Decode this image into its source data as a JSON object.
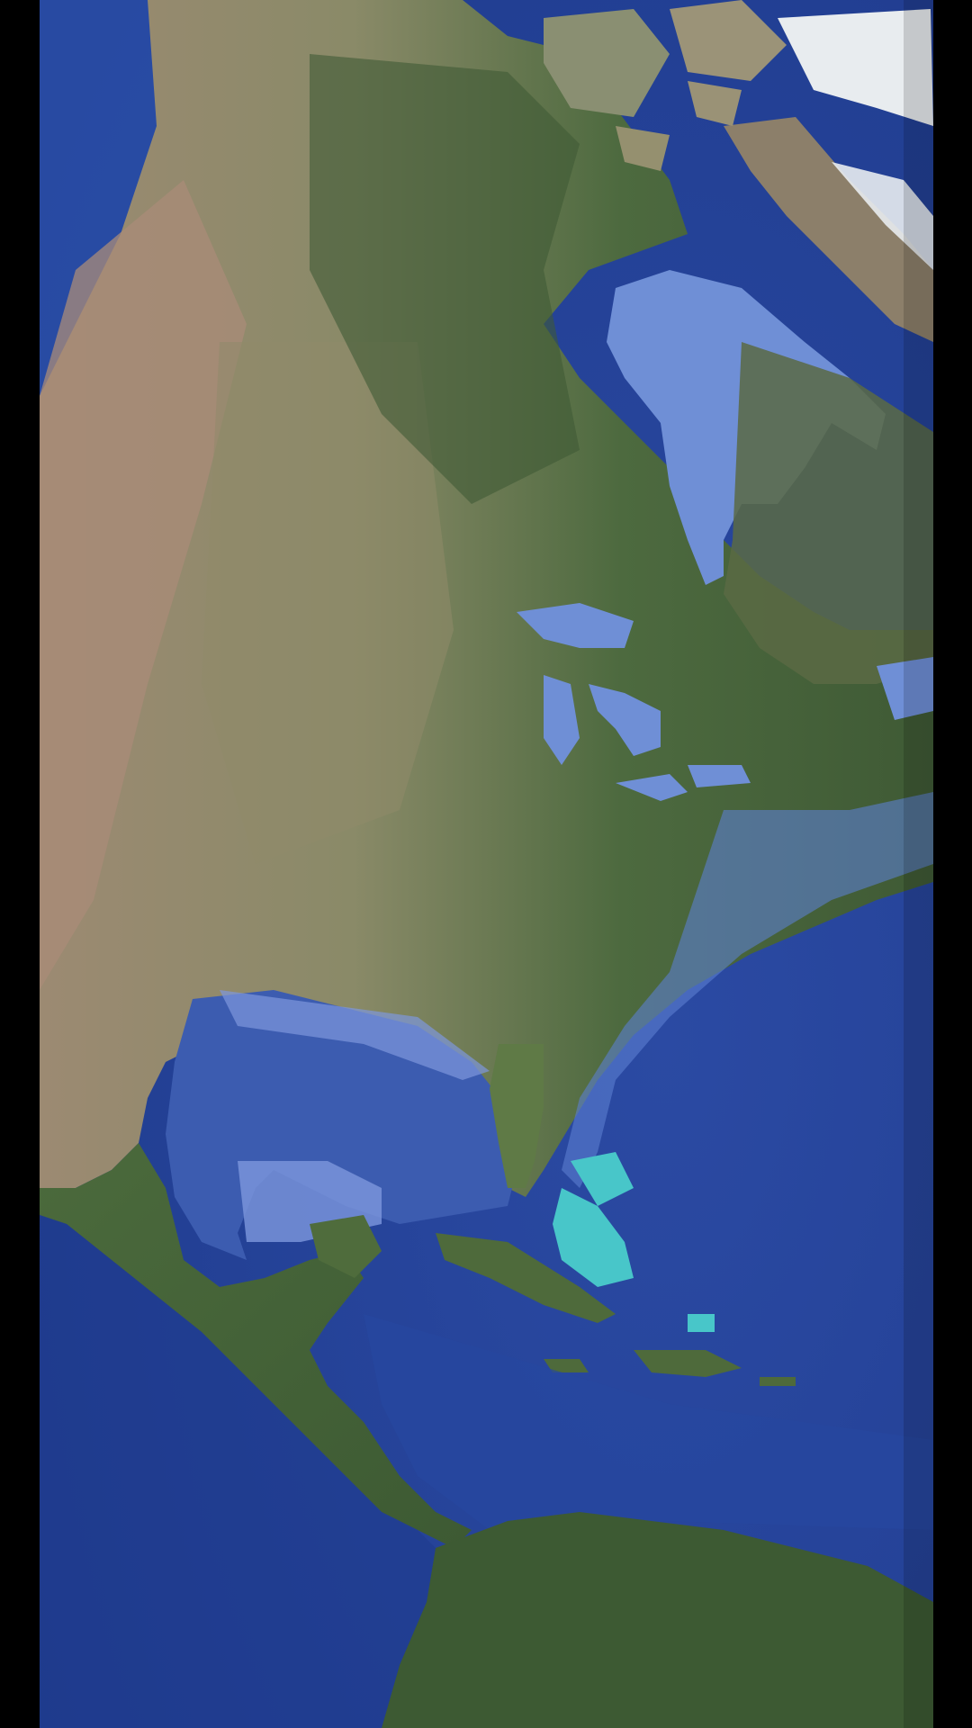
{
  "view": {
    "type": "satellite-imagery",
    "region": "North America",
    "labels_visible": false
  },
  "colors": {
    "letterbox": "#000000",
    "deep_ocean": "#1e3a8c",
    "ocean": "#3a5cb8",
    "shelf_water": "#6f8fd6",
    "shallow_banks": "#48c6c9",
    "forest": "#3f5a35",
    "plains": "#8a8a68",
    "desert": "#a98b78",
    "ice": "#e8ecef"
  }
}
